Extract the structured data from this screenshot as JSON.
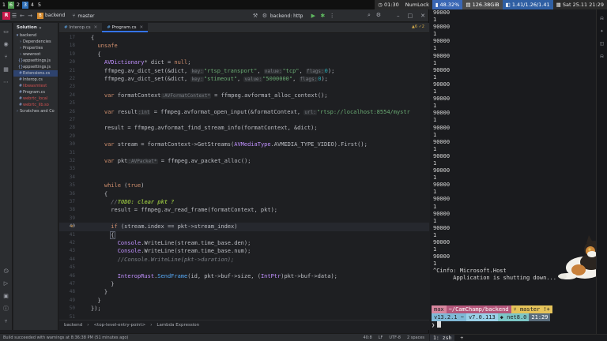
{
  "sysbar": {
    "workspaces": [
      "1",
      "6",
      "2",
      "3",
      "4",
      "5"
    ],
    "time": "01:30",
    "numlock": "NumLock",
    "battery": "48.32%",
    "disk": "126.38GiB",
    "load": "1.41/1.26/1.41",
    "date": "Sat 25.11 21:29"
  },
  "ide": {
    "project": "backend",
    "branch": "master",
    "run_config": "backend: http",
    "panel_title": "Solution",
    "tree": [
      {
        "icon": "▾",
        "label": "backend",
        "sel": false,
        "red": false
      },
      {
        "icon": "›",
        "label": "Dependencies",
        "sel": false,
        "red": false
      },
      {
        "icon": "›",
        "label": "Properties",
        "sel": false,
        "red": false
      },
      {
        "icon": "›",
        "label": "wwwroot",
        "sel": false,
        "red": false
      },
      {
        "icon": "{}",
        "label": "appsettings.js",
        "sel": false,
        "red": false
      },
      {
        "icon": "{}",
        "label": "appsettings.js",
        "sel": false,
        "red": false
      },
      {
        "icon": "#",
        "label": "Extensions.cs",
        "sel": true,
        "red": false
      },
      {
        "icon": "#",
        "label": "Interop.cs",
        "sel": false,
        "red": false
      },
      {
        "icon": "#",
        "label": "libwasmtest",
        "sel": false,
        "red": true
      },
      {
        "icon": "#",
        "label": "Program.cs",
        "sel": false,
        "red": false
      },
      {
        "icon": "#",
        "label": "webrtc_local",
        "sel": false,
        "red": true
      },
      {
        "icon": "#",
        "label": "webrtc_lib.so",
        "sel": false,
        "red": true
      },
      {
        "icon": "›",
        "label": "Scratches and Co",
        "sel": false,
        "red": false
      }
    ],
    "tabs": [
      {
        "label": "Interop.cs",
        "active": false
      },
      {
        "label": "Program.cs",
        "active": true
      }
    ],
    "warnings": "▲6 ✓2",
    "breadcrumbs": [
      "backend",
      "<top-level-entry-point>",
      "Lambda Expression"
    ],
    "status_left": "Build succeeded with warnings at 8:36:38 PM (51 minutes ago)",
    "status_right": [
      "40:8",
      "LF",
      "UTF-8",
      "2 spaces"
    ],
    "code_lines": [
      {
        "n": "17",
        "html": "{"
      },
      {
        "n": "18",
        "html": "  <span class=\"kw\">unsafe</span>"
      },
      {
        "n": "19",
        "html": "  {"
      },
      {
        "n": "20",
        "html": "    <span class=\"ty\">AVDictionary</span>* dict = <span class=\"kw\">null</span>;"
      },
      {
        "n": "21",
        "html": "    ffmpeg.av_dict_set(&amp;dict, <span class=\"hint\">key:</span><span class=\"st\">\"rtsp_transport\"</span>, <span class=\"hint\">value:</span><span class=\"st\">\"tcp\"</span>, <span class=\"hint\">flags:</span><span class=\"nu\">0</span>);"
      },
      {
        "n": "22",
        "html": "    ffmpeg.av_dict_set(&amp;dict, <span class=\"hint\">key:</span><span class=\"st\">\"stimeout\"</span>, <span class=\"hint\">value:</span><span class=\"st\">\"5000000\"</span>, <span class=\"hint\">flags:</span><span class=\"nu\">0</span>);"
      },
      {
        "n": "23",
        "html": ""
      },
      {
        "n": "24",
        "html": "    <span class=\"kw\">var</span> formatContext<span class=\"hint\">:AVFormatContext*</span> = ffmpeg.avformat_alloc_context();"
      },
      {
        "n": "25",
        "html": ""
      },
      {
        "n": "26",
        "html": "    <span class=\"kw\">var</span> result<span class=\"hint\">:int</span> = ffmpeg.avformat_open_input(&amp;formatContext, <span class=\"hint\">url:</span><span class=\"st\">\"rtsp://localhost:8554/mystr</span>"
      },
      {
        "n": "27",
        "html": ""
      },
      {
        "n": "28",
        "html": "    result = ffmpeg.avformat_find_stream_info(formatContext, &amp;dict);"
      },
      {
        "n": "29",
        "html": ""
      },
      {
        "n": "30",
        "html": "    <span class=\"kw\">var</span> stream = formatContext-&gt;GetStreams(<span class=\"ty\">AVMediaType</span>.AVMEDIA_TYPE_VIDEO).First();"
      },
      {
        "n": "31",
        "html": ""
      },
      {
        "n": "32",
        "html": "    <span class=\"kw\">var</span> pkt<span class=\"hint\">:AVPacket*</span> = ffmpeg.av_packet_alloc();"
      },
      {
        "n": "33",
        "html": ""
      },
      {
        "n": "34",
        "html": ""
      },
      {
        "n": "35",
        "html": "    <span class=\"kw\">while</span> (<span class=\"kw\">true</span>)"
      },
      {
        "n": "36",
        "html": "    {"
      },
      {
        "n": "37",
        "html": "      <span class=\"cm\">//</span><span class=\"td\">TODO: clear pkt ?</span>"
      },
      {
        "n": "38",
        "html": "      result = ffmpeg.av_read_frame(formatContext, pkt);"
      },
      {
        "n": "39",
        "html": ""
      },
      {
        "n": "40",
        "html": "      <span class=\"kw\">if</span> (stream.index == pkt-&gt;stream_index)"
      },
      {
        "n": "41",
        "html": "      <span class=\"cursor-br\">{</span>"
      },
      {
        "n": "42",
        "html": "        <span class=\"ty\">Console</span>.WriteLine(stream.time_base.den);"
      },
      {
        "n": "43",
        "html": "        <span class=\"ty\">Console</span>.WriteLine(stream.time_base.num);"
      },
      {
        "n": "44",
        "html": "        <span class=\"cm\">//Console.WriteLine(pkt-&gt;duration);</span>"
      },
      {
        "n": "45",
        "html": ""
      },
      {
        "n": "46",
        "html": "        <span class=\"ty\">InteropRust</span>.<span class=\"fn\">SendFrame</span>(id, pkt-&gt;buf-&gt;size, (<span class=\"ty\">IntPtr</span>)pkt-&gt;buf-&gt;data);"
      },
      {
        "n": "47",
        "html": "      }"
      },
      {
        "n": "48",
        "html": "    }"
      },
      {
        "n": "49",
        "html": "  }"
      },
      {
        "n": "50",
        "html": "});"
      },
      {
        "n": "51",
        "html": ""
      },
      {
        "n": "52",
        "html": "app.MapGet(<span class=\"hint\">pattern:</span><span class=\"st\">\"/webrtc/start\"</span>, <span class=\"hint\">handler:</span>() =&gt;"
      }
    ],
    "current_line": "40"
  },
  "terminal": {
    "lines": [
      "90000",
      "1",
      "90000",
      "1",
      "90000",
      "1",
      "90000",
      "1",
      "90000",
      "1",
      "90000",
      "1",
      "90000",
      "1",
      "90000",
      "1",
      "90000",
      "1",
      "90000",
      "1",
      "90000",
      "1",
      "90000",
      "1",
      "90000",
      "1",
      "90000",
      "1",
      "90000",
      "1",
      "90000",
      "1",
      "90000",
      "1",
      "90000",
      "1",
      "^Cinfo: Microsoft.Host",
      "      Application is shutting down..."
    ],
    "prompt": {
      "user": "max",
      "path": "~/CamChamp/backend",
      "git": "master !+",
      "version": "v13.2.1",
      "arrow": "~",
      "node": "v7.0.113",
      "dotnet": "net8.0",
      "time": "21:29",
      "input_prompt": "❯"
    },
    "tmux_window": "1: zsh",
    "tmux_plus": "+"
  }
}
